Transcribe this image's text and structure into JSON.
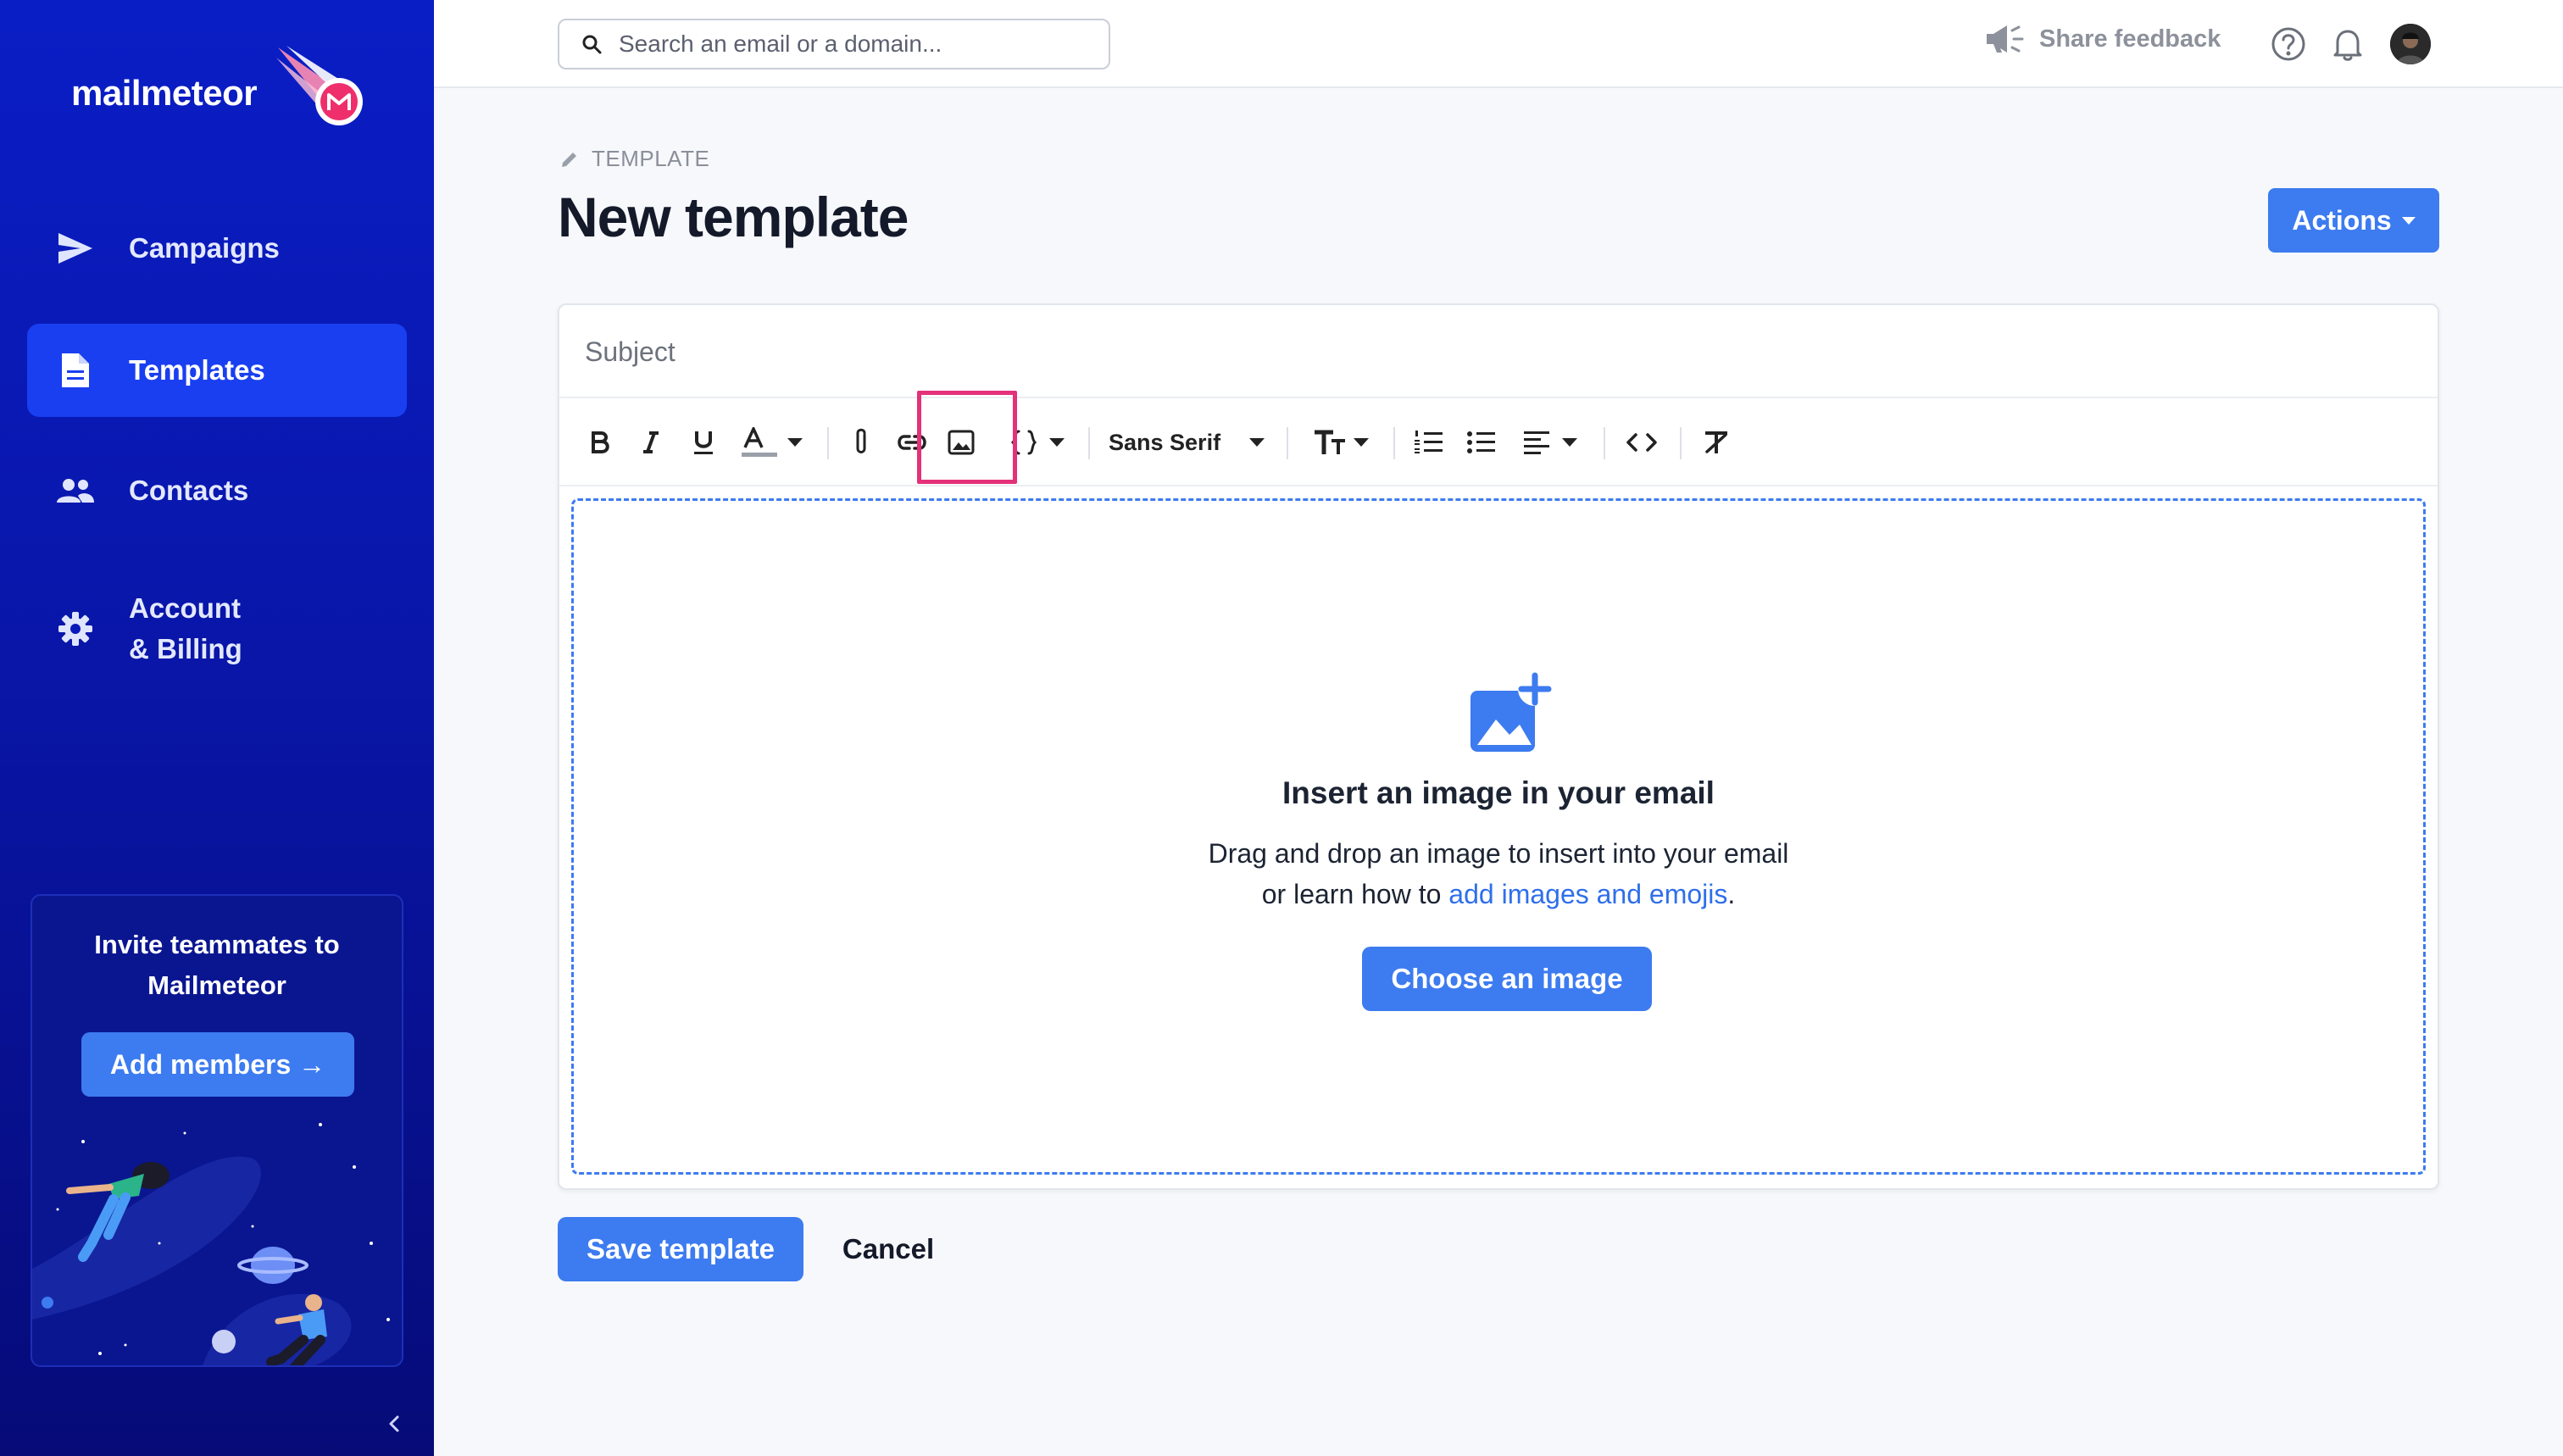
{
  "brand": {
    "name": "mailmeteor",
    "accent": "#3d7bf0",
    "highlight": "#e4317a"
  },
  "sidebar": {
    "items": [
      {
        "label": "Campaigns",
        "icon": "send-icon",
        "active": false
      },
      {
        "label": "Templates",
        "icon": "document-icon",
        "active": true
      },
      {
        "label": "Contacts",
        "icon": "people-icon",
        "active": false
      },
      {
        "label": "Account",
        "label2": "& Billing",
        "icon": "gear-icon",
        "active": false
      }
    ],
    "invite": {
      "title_line1": "Invite teammates to",
      "title_line2": "Mailmeteor",
      "button_label": "Add members →"
    }
  },
  "topbar": {
    "search_placeholder": "Search an email or a domain...",
    "feedback_label": "Share feedback"
  },
  "page": {
    "breadcrumb": "TEMPLATE",
    "title": "New template",
    "actions_label": "Actions"
  },
  "editor": {
    "subject_placeholder": "Subject",
    "toolbar": {
      "font_family": "Sans Serif"
    },
    "dropzone": {
      "title": "Insert an image in your email",
      "line1": "Drag and drop an image to insert into your email",
      "line2_prefix": "or learn how to ",
      "line2_link": "add images and emojis",
      "line2_suffix": ".",
      "button_label": "Choose an image"
    }
  },
  "footer": {
    "save_label": "Save template",
    "cancel_label": "Cancel"
  }
}
